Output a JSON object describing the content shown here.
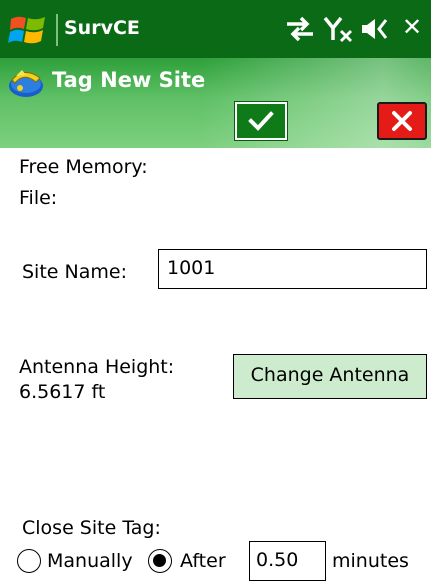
{
  "status_bar": {
    "app_name": "SurvCE",
    "icons": [
      "windows-start-icon",
      "connectivity-icon",
      "no-signal-icon",
      "volume-icon",
      "close-icon"
    ],
    "close_glyph": "✕"
  },
  "header": {
    "title": "Tag New Site",
    "icon": "survce-app-icon",
    "ok_icon": "checkmark-icon",
    "cancel_icon": "close-x-icon"
  },
  "info": {
    "free_memory_label": "Free Memory:",
    "file_label": "File:"
  },
  "site": {
    "label": "Site Name:",
    "value": "1001"
  },
  "antenna": {
    "label": "Antenna Height:",
    "value": "6.5617 ft",
    "change_button": "Change Antenna"
  },
  "close_tag": {
    "label": "Close Site Tag:",
    "option_manual": "Manually",
    "option_after": "After",
    "selected": "After",
    "minutes_value": "0.50",
    "minutes_label": "minutes"
  },
  "colors": {
    "status_bar": "#0a6a16",
    "header_green": "#4fb556",
    "ok_green": "#0e7a18",
    "cancel_red": "#e41b17",
    "button_bg": "#cdeccd"
  }
}
